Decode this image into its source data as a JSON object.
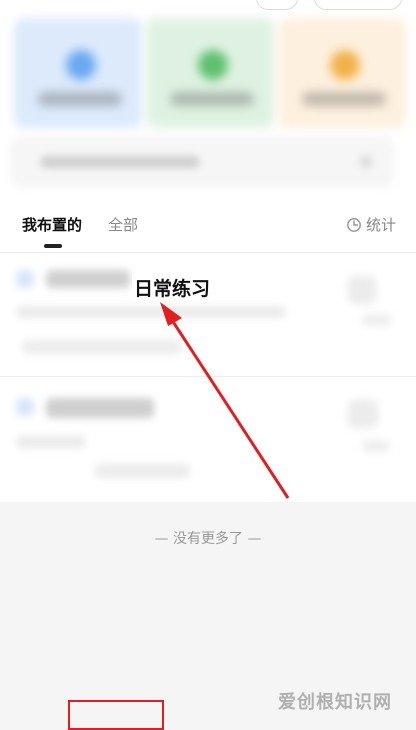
{
  "tabs": [
    {
      "label": "我布置的",
      "active": true
    },
    {
      "label": "全部",
      "active": false
    }
  ],
  "stats_label": "统计",
  "item_title": "日常练习",
  "list_end_text": "— 没有更多了 —",
  "watermark": "爱创根知识网",
  "colors": {
    "annotation_red": "#e02020",
    "card_blue": "#dceafc",
    "card_green": "#dff2e2",
    "card_orange": "#fdf0de"
  }
}
